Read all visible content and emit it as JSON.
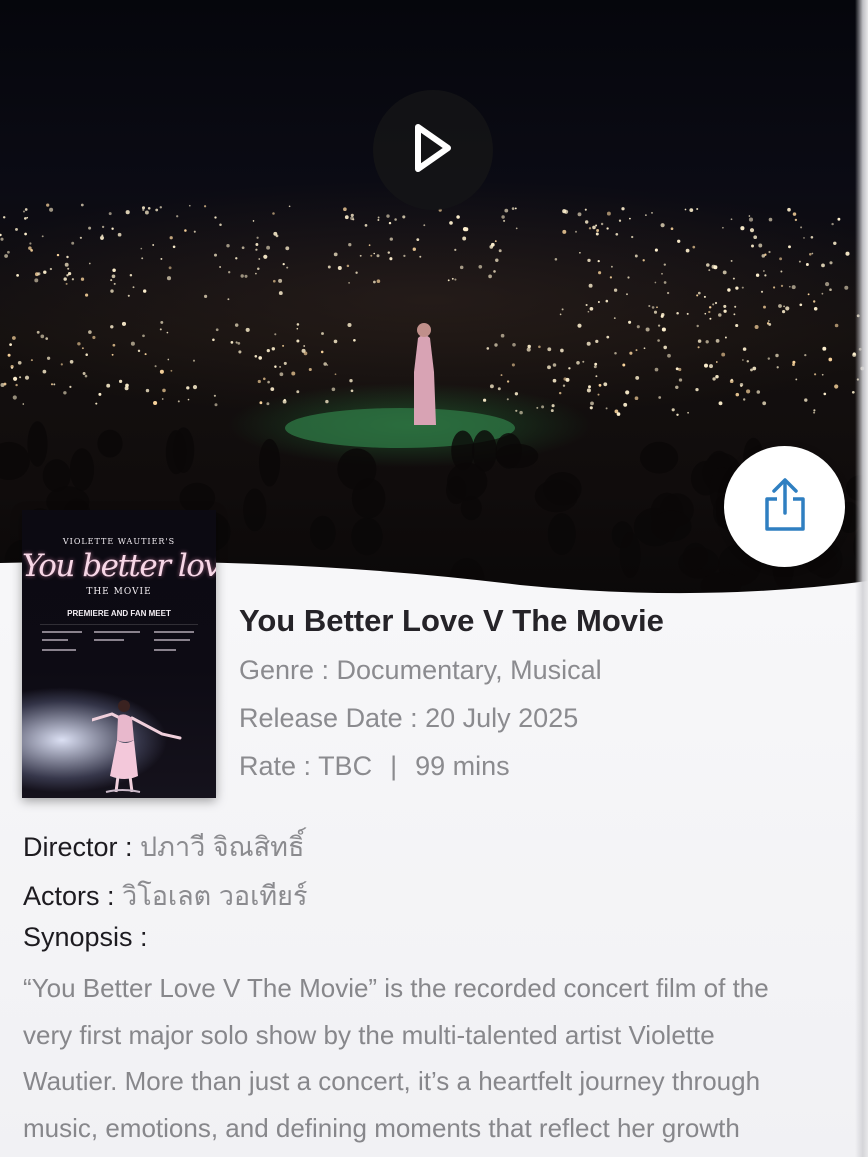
{
  "trailer": {
    "play_icon": "play-icon",
    "share_icon": "share-icon"
  },
  "poster": {
    "artist": "VIOLETTE WAUTIER'S",
    "title": "You better love V",
    "subtitle": "THE MOVIE",
    "premiere": "PREMIERE AND FAN MEET"
  },
  "movie": {
    "title": "You Better Love V The Movie",
    "genre_label": "Genre : ",
    "genre": "Documentary, Musical",
    "release_label": "Release Date : ",
    "release_date": "20 July 2025",
    "rate_label": "Rate : ",
    "rate": "TBC",
    "separator": "|",
    "duration": "99 mins",
    "director_label": "Director : ",
    "director": "ปภาวี จิณสิทธิ์",
    "actors_label": "Actors : ",
    "actors": "วิโอเลต วอเทียร์",
    "synopsis_label": "Synopsis :",
    "synopsis_lines": [
      " “You Better Love V The Movie” is the recorded concert film of the",
      "very first major solo show by the multi-talented artist Violette",
      "Wautier. More than just a concert, it’s a heartfelt journey through",
      "music, emotions, and defining moments that reflect her growth"
    ]
  },
  "colors": {
    "title": "#252328",
    "secondary_text": "#8b8b8f",
    "primary_text": "#1d1b20",
    "share_icon": "#2f7fc1"
  }
}
